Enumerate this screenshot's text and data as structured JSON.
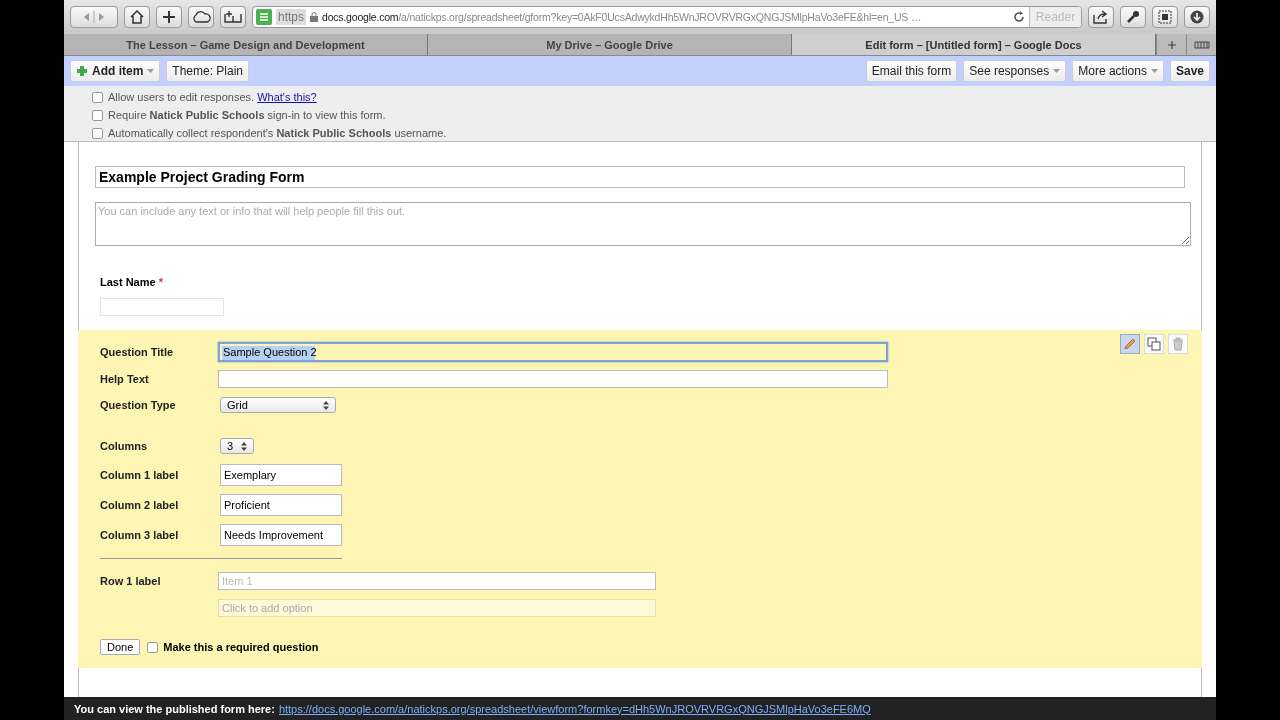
{
  "browser": {
    "url": {
      "scheme": "https",
      "host": "docs.google.com",
      "path": "/a/natickps.org/spreadsheet/gform?key=0AkF0UcsAdwykdHh5WnJROVRVRGxQNGJSMlpHaVo3eFE&hl=en_US …"
    },
    "reader": "Reader",
    "tabs": [
      {
        "label": "The Lesson – Game Design and Development",
        "selected": false
      },
      {
        "label": "My Drive – Google Drive",
        "selected": false
      },
      {
        "label": "Edit form – [Untitled form] – Google Docs",
        "selected": true
      }
    ]
  },
  "toolbar": {
    "left": [
      {
        "label": "Add item",
        "kind": "add",
        "dropdown": true
      },
      {
        "label": "Theme:  Plain",
        "kind": "plain",
        "dropdown": false
      }
    ],
    "right": [
      {
        "label": "Email this form",
        "dropdown": false,
        "bold": false
      },
      {
        "label": "See responses",
        "dropdown": true,
        "bold": false
      },
      {
        "label": "More actions",
        "dropdown": true,
        "bold": false
      },
      {
        "label": "Save",
        "dropdown": false,
        "bold": true
      }
    ]
  },
  "settings": [
    {
      "text": "Allow users to edit responses.",
      "link": "What's this?",
      "checked": false
    },
    {
      "text": "Require **Natick Public Schools** sign-in to view this form.",
      "checked": false
    },
    {
      "text": "Automatically collect respondent's **Natick Public Schools** username.",
      "checked": false
    }
  ],
  "form": {
    "title": "Example Project Grading Form",
    "description_placeholder": "You can include any text or info that will help people fill this out.",
    "question": {
      "label": "Last Name",
      "required": true,
      "required_mark": "*"
    }
  },
  "editor": {
    "rows": [
      {
        "label": "Question Title",
        "kind": "wide",
        "value": "Sample Question 2",
        "focused": true
      },
      {
        "label": "Help Text",
        "kind": "wide",
        "value": "",
        "focused": false
      },
      {
        "label": "Question Type",
        "kind": "select",
        "value": "Grid"
      },
      {
        "label": "Columns",
        "kind": "small-select",
        "value": "3"
      },
      {
        "label": "Column 1 label",
        "kind": "short",
        "value": "Exemplary"
      },
      {
        "label": "Column 2 label",
        "kind": "short",
        "value": "Proficient"
      },
      {
        "label": "Column 3 label",
        "kind": "short",
        "value": "Needs Improvement"
      },
      {
        "label": "Row 1 label",
        "kind": "option",
        "placeholder": "Item 1"
      }
    ],
    "add_option": "Click to add option",
    "done": "Done",
    "required_label": "Make this a required question",
    "required": false
  },
  "status": {
    "text": "You can view the published form here:",
    "link": "https://docs.google.com/a/natickps.org/spreadsheet/viewform?formkey=dHh5WnJROVRVRGxQNGJSMlpHaVo3eFE6MQ"
  }
}
